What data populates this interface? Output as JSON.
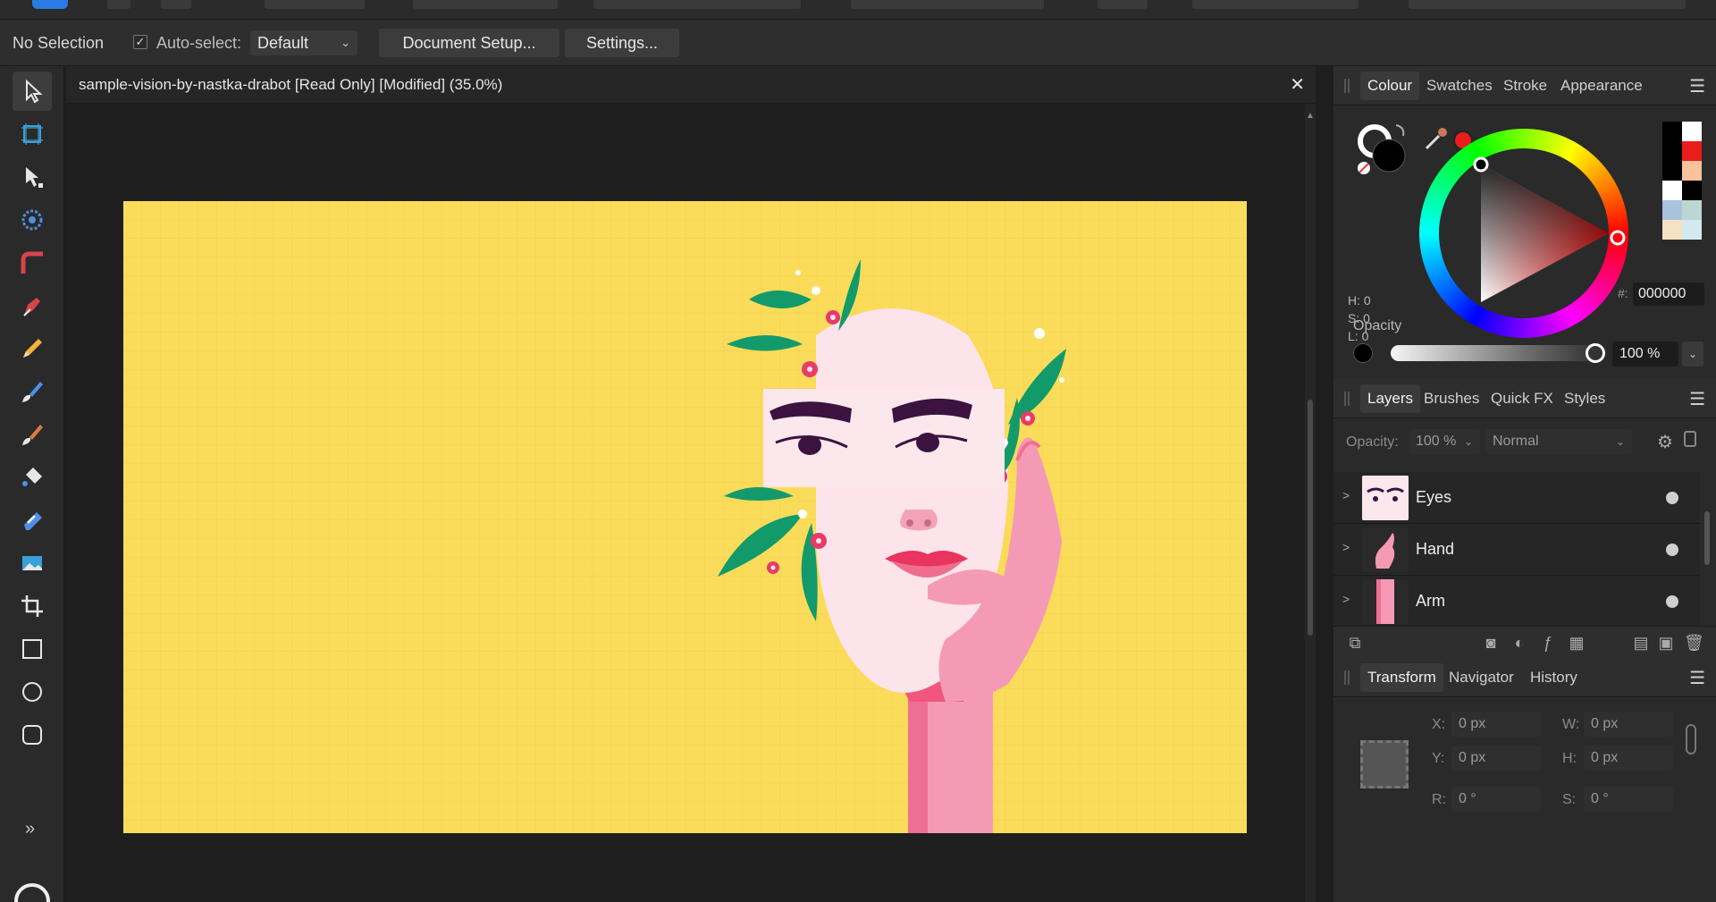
{
  "context_bar": {
    "selection": "No Selection",
    "auto_select_label": "Auto-select:",
    "auto_select_checked": "✓",
    "auto_select_value": "Default",
    "document_setup": "Document Setup...",
    "settings": "Settings..."
  },
  "tools": [
    {
      "name": "move-tool-icon"
    },
    {
      "name": "artboard-tool-icon"
    },
    {
      "name": "node-tool-icon"
    },
    {
      "name": "point-transform-tool-icon"
    },
    {
      "name": "corner-tool-icon"
    },
    {
      "name": "pen-tool-icon"
    },
    {
      "name": "pencil-tool-icon"
    },
    {
      "name": "vector-brush-tool-icon"
    },
    {
      "name": "paint-brush-tool-icon"
    },
    {
      "name": "fill-tool-icon"
    },
    {
      "name": "transparency-tool-icon"
    },
    {
      "name": "place-image-tool-icon"
    },
    {
      "name": "crop-tool-icon"
    },
    {
      "name": "rectangle-tool-icon"
    },
    {
      "name": "ellipse-tool-icon"
    },
    {
      "name": "rounded-rectangle-tool-icon"
    }
  ],
  "tools_expand": "»",
  "document": {
    "title": "sample-vision-by-nastka-drabot [Read Only] [Modified] (35.0%)",
    "close": "✕",
    "scroll_up": "▲",
    "artboard_color": "#fbdc5a"
  },
  "colour_panel": {
    "tabs": [
      "Colour",
      "Swatches",
      "Stroke",
      "Appearance"
    ],
    "menu": "☰",
    "h": "H: 0",
    "s": "S: 0",
    "l": "L: 0",
    "hash": "#:",
    "hex": "000000",
    "opacity_label": "Opacity",
    "opacity_value": "100 %",
    "opacity_drop": "⌄"
  },
  "layers_panel": {
    "tabs": [
      "Layers",
      "Brushes",
      "Quick FX",
      "Styles"
    ],
    "menu": "☰",
    "opacity_label": "Opacity:",
    "opacity_value": "100 %",
    "blend_mode": "Normal",
    "layers": [
      {
        "name": "Eyes",
        "expander": ">"
      },
      {
        "name": "Hand",
        "expander": ">"
      },
      {
        "name": "Arm",
        "expander": ">"
      }
    ]
  },
  "transform_panel": {
    "tabs": [
      "Transform",
      "Navigator",
      "History"
    ],
    "menu": "☰",
    "x_label": "X:",
    "x_value": "0 px",
    "y_label": "Y:",
    "y_value": "0 px",
    "w_label": "W:",
    "w_value": "0 px",
    "h_label": "H:",
    "h_value": "0 px",
    "r_label": "R:",
    "r_value": "0 °",
    "s_label": "S:",
    "s_value": "0 °"
  }
}
